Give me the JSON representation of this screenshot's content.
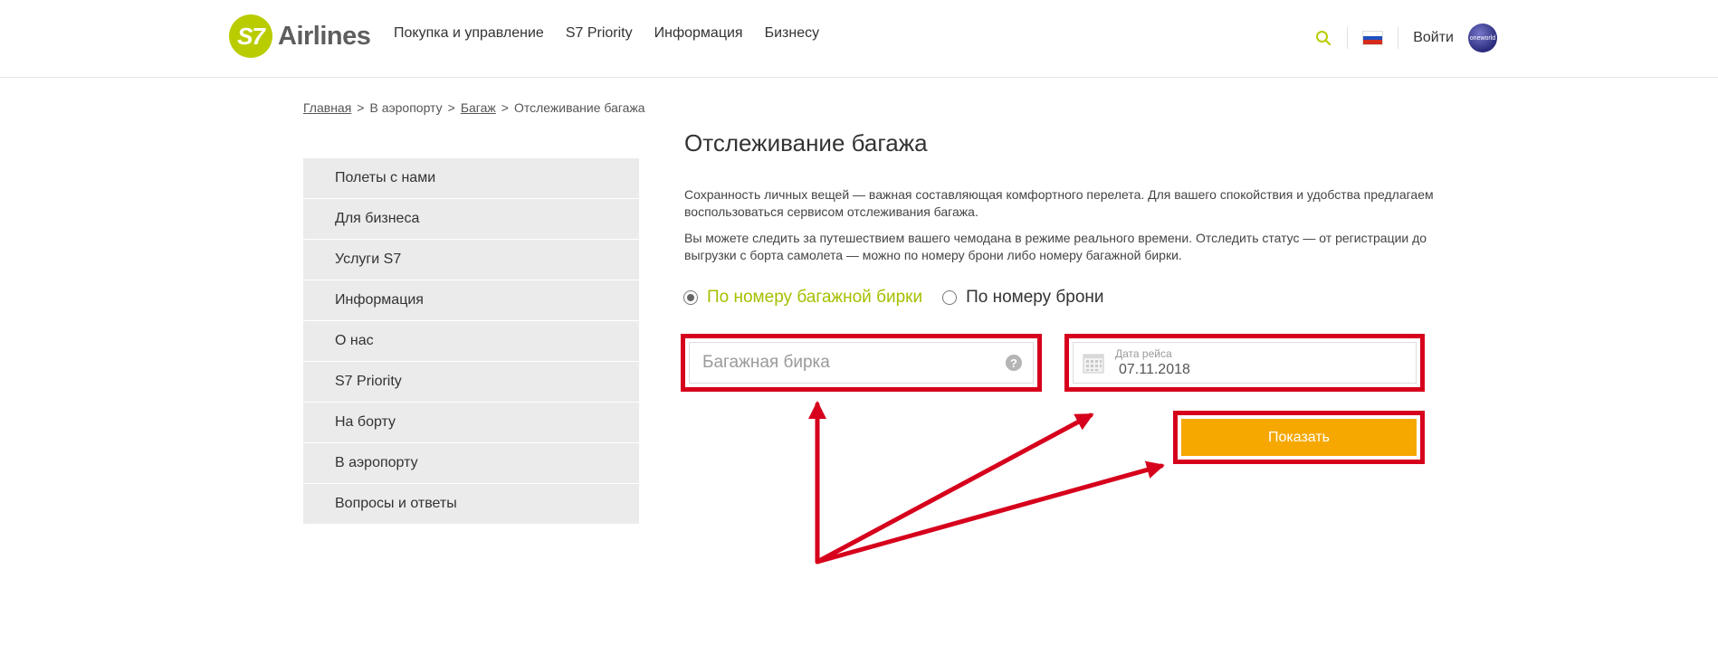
{
  "header": {
    "logo": {
      "mark": "S7",
      "word": "Airlines"
    },
    "nav": [
      "Покупка и управление",
      "S7 Priority",
      "Информация",
      "Бизнесу"
    ],
    "search_icon": "search-icon",
    "language_flag": "russian-flag-icon",
    "login_label": "Войти",
    "alliance_logo": "oneworld"
  },
  "breadcrumb": {
    "items": [
      "Главная",
      "В аэропорту",
      "Багаж",
      "Отслеживание багажа"
    ],
    "separator": ">"
  },
  "sidebar": {
    "items": [
      "Полеты с нами",
      "Для бизнеса",
      "Услуги S7",
      "Информация",
      "О нас",
      "S7 Priority",
      "На борту",
      "В аэропорту",
      "Вопросы и ответы"
    ]
  },
  "main": {
    "title": "Отслеживание багажа",
    "paragraph1": "Сохранность личных вещей — важная составляющая комфортного перелета. Для вашего спокойствия и удобства предлагаем воспользоваться сервисом отслеживания багажа.",
    "paragraph2": "Вы можете следить за путешествием вашего чемодана в режиме реального времени. Отследить статус — от регистрации до выгрузки с борта самолета — можно по номеру брони либо номеру багажной бирки.",
    "options": [
      {
        "label": "По номеру багажной бирки",
        "selected": true
      },
      {
        "label": "По номеру брони",
        "selected": false
      }
    ],
    "tag_field": {
      "placeholder": "Багажная бирка",
      "value": ""
    },
    "help_icon": "?",
    "date_field": {
      "label": "Дата рейса",
      "value": "07.11.2018"
    },
    "show_button": "Показать"
  },
  "colors": {
    "brand_green": "#b9cc00",
    "selected_option": "#a7bf00",
    "button_orange": "#f6a800",
    "annotation_red": "#d6001c",
    "sidebar_bg": "#ebebeb"
  }
}
